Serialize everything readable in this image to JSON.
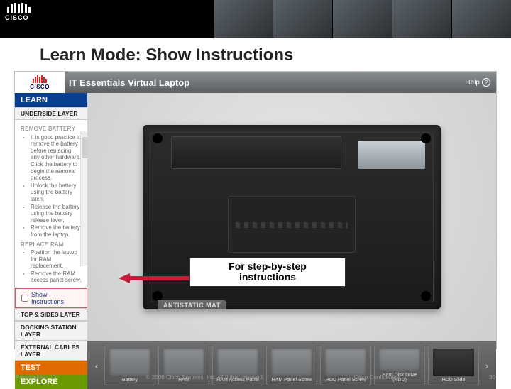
{
  "slide": {
    "title": "Learn Mode: Show Instructions",
    "presentation_id": "Presentation_ID",
    "copyright": "© 2008 Cisco Systems, Inc. All rights reserved.",
    "confidential": "Cisco Confidential",
    "page_number": "30"
  },
  "brand": {
    "cisco": "CISCO"
  },
  "app": {
    "title": "IT Essentials Virtual Laptop",
    "help": "Help",
    "modes": {
      "learn": "LEARN",
      "test": "TEST",
      "explore": "EXPLORE"
    },
    "layers": {
      "underside": "UNDERSIDE LAYER",
      "top_sides": "TOP & SIDES LAYER",
      "docking": "DOCKING STATION LAYER",
      "external": "EXTERNAL CABLES LAYER"
    },
    "instructions": {
      "remove_battery": {
        "title": "REMOVE BATTERY",
        "steps": [
          "It is good practice to remove the battery before replacing any other hardware. Click the battery to begin the removal process.",
          "Unlock the battery using the battery latch.",
          "Release the battery using the battery release lever.",
          "Remove the battery from the laptop."
        ]
      },
      "replace_ram": {
        "title": "REPLACE RAM",
        "steps": [
          "Position the laptop for RAM replacement.",
          "Remove the RAM access panel screw."
        ]
      }
    },
    "show_instructions": {
      "label": "Show Instructions",
      "checked": false
    },
    "mat_label": "ANTISTATIC MAT",
    "parts": [
      {
        "label": "Battery"
      },
      {
        "label": "RAM"
      },
      {
        "label": "RAM Access Panel"
      },
      {
        "label": "RAM Panel Screw"
      },
      {
        "label": "HDD Panel Screw"
      },
      {
        "label": "Hard Disk Drive (HDD)"
      },
      {
        "label": "HDD Slide"
      }
    ]
  },
  "callout": {
    "line1": "For step-by-step",
    "line2": "instructions"
  },
  "colors": {
    "learn": "#0a3f8f",
    "test": "#e06a00",
    "explore": "#6a9a00",
    "arrow": "#c81b3a"
  }
}
